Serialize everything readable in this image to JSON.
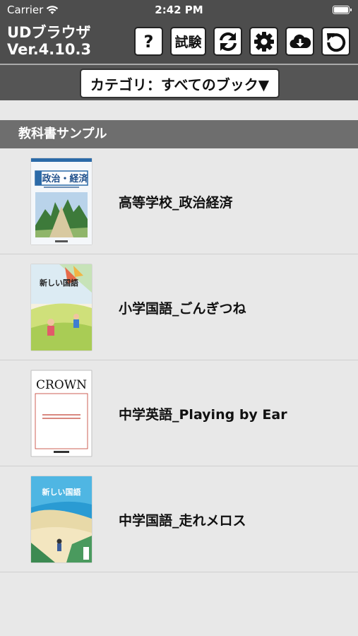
{
  "status_bar": {
    "carrier": "Carrier",
    "time": "2:42 PM"
  },
  "app": {
    "name": "UDブラウザ",
    "version": "Ver.4.10.3"
  },
  "toolbar": {
    "help_label": "?",
    "test_label": "試験"
  },
  "category": {
    "label": "カテゴリ：すべてのブック▼"
  },
  "section": {
    "title": "教科書サンプル"
  },
  "books": [
    {
      "title": "高等学校_政治経済",
      "cover_text": "政治・経済"
    },
    {
      "title": "小学国語_ごんぎつね",
      "cover_text": "新しい国語"
    },
    {
      "title": "中学英語_Playing by Ear",
      "cover_text": "CROWN"
    },
    {
      "title": "中学国語_走れメロス",
      "cover_text": "新しい国語"
    }
  ],
  "colors": {
    "header_bg": "#4d4d4d",
    "section_bg": "#6e6e6e",
    "list_bg": "#e8e8e8"
  }
}
